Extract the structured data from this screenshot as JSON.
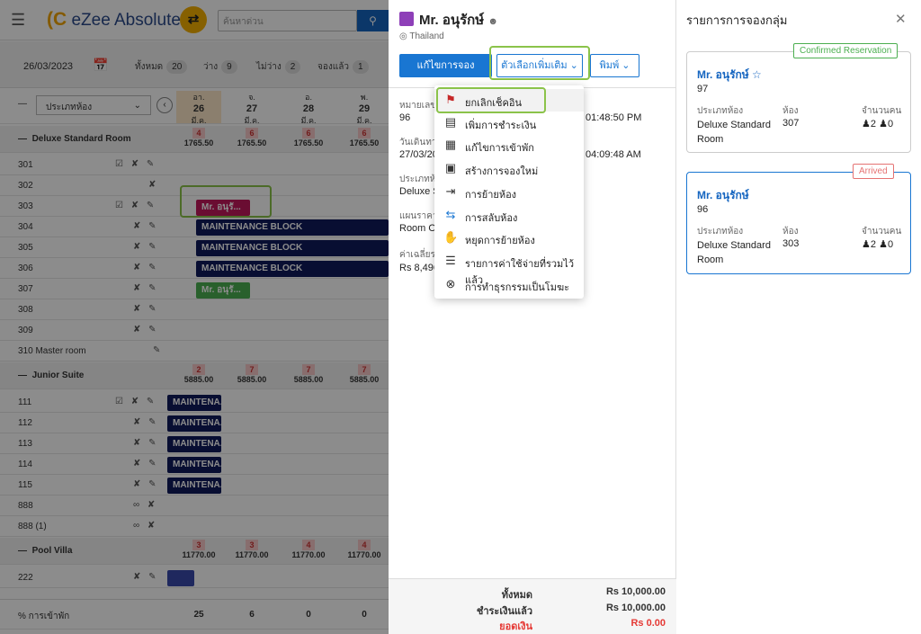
{
  "app": {
    "logo_text": "eZee Absolute",
    "search_placeholder": "ค้นหาด่วน",
    "date": "26/03/2023",
    "stats": [
      {
        "label": "ทั้งหมด",
        "value": "20"
      },
      {
        "label": "ว่าง",
        "value": "9"
      },
      {
        "label": "ไม่ว่าง",
        "value": "2"
      },
      {
        "label": "จองแล้ว",
        "value": "1"
      }
    ],
    "room_type_select": "ประเภทห้อง",
    "dates": [
      {
        "day": "อา.",
        "num": "26",
        "month": "มี.ค."
      },
      {
        "day": "จ.",
        "num": "27",
        "month": "มี.ค."
      },
      {
        "day": "อ.",
        "num": "28",
        "month": "มี.ค."
      },
      {
        "day": "พ.",
        "num": "29",
        "month": "มี.ค."
      }
    ],
    "categories": [
      {
        "name": "Deluxe Standard Room",
        "counts": [
          "4",
          "6",
          "6",
          "6"
        ],
        "prices": [
          "1765.50",
          "1765.50",
          "1765.50",
          "1765.50"
        ]
      },
      {
        "name": "Junior Suite",
        "counts": [
          "2",
          "7",
          "7",
          "7"
        ],
        "prices": [
          "5885.00",
          "5885.00",
          "5885.00",
          "5885.00"
        ]
      },
      {
        "name": "Pool Villa",
        "counts": [
          "3",
          "3",
          "4",
          "4"
        ],
        "prices": [
          "11770.00",
          "11770.00",
          "11770.00",
          "11770.00"
        ]
      }
    ],
    "rooms_deluxe": [
      "301",
      "302",
      "303",
      "304",
      "305",
      "306",
      "307",
      "308",
      "309",
      "310 Master room"
    ],
    "rooms_junior": [
      "111",
      "112",
      "113",
      "114",
      "115",
      "888",
      "888 (1)"
    ],
    "rooms_villa": [
      "222"
    ],
    "maintenance_long": "MAINTENANCE BLOCK",
    "maintenance_short": "MAINTENA...",
    "booking_short": "Mr. อนุรั...",
    "occupancy_label": "% การเข้าพัก",
    "occupancy": [
      "25",
      "6",
      "0",
      "0"
    ]
  },
  "detail": {
    "guest_name": "Mr. อนุรักษ์",
    "country": "Thailand",
    "edit_button": "แก้ไขการจอง",
    "more_button": "ตัวเลือกเพิ่มเติม",
    "print_button": "พิมพ์",
    "field1_label": "หมายเลข",
    "field1_value": "96",
    "field1_time": "01:48:50 PM",
    "field2_label": "วันเดินทาง",
    "field2_value": "27/03/20",
    "field2_time": "04:09:48 AM",
    "field3_label": "ประเภทห้อง",
    "field3_value": "Deluxe S",
    "field4_label": "แผนราคา",
    "field4_value": "Room On",
    "field5_label": "ค่าเฉลี่ยรา",
    "field5_value": "Rs 8,496",
    "totals": [
      {
        "label": "ทั้งหมด",
        "value": "Rs 10,000.00"
      },
      {
        "label": "ชำระเงินแล้ว",
        "value": "Rs 10,000.00"
      },
      {
        "label": "ยอดเงิน",
        "value": "Rs 0.00"
      }
    ]
  },
  "menu": [
    {
      "icon": "cancel-checkin-icon",
      "label": "ยกเลิกเช็คอิน"
    },
    {
      "icon": "add-payment-icon",
      "label": "เพิ่มการชำระเงิน"
    },
    {
      "icon": "edit-stay-icon",
      "label": "แก้ไขการเข้าพัก"
    },
    {
      "icon": "new-booking-icon",
      "label": "สร้างการจองใหม่"
    },
    {
      "icon": "move-room-icon",
      "label": "การย้ายห้อง"
    },
    {
      "icon": "swap-room-icon",
      "label": "การสลับห้อง"
    },
    {
      "icon": "stop-move-icon",
      "label": "หยุดการย้ายห้อง"
    },
    {
      "icon": "expense-list-icon",
      "label": "รายการค่าใช้จ่ายที่รวมไว้แล้ว"
    },
    {
      "icon": "void-transaction-icon",
      "label": "การทำธุรกรรมเป็นโมฆะ"
    }
  ],
  "group": {
    "title": "รายการการจองกลุ่ม",
    "cards": [
      {
        "badge": "Confirmed Reservation",
        "badge_color": "#4caf50",
        "name": "Mr. อนุรักษ์",
        "number": "97",
        "room_type_label": "ประเภทห้อง",
        "room_type": "Deluxe Standard Room",
        "room_label": "ห้อง",
        "room": "307",
        "pax_label": "จำนวนคน",
        "adults": "2",
        "children": "0"
      },
      {
        "badge": "Arrived",
        "badge_color": "#e57373",
        "name": "Mr. อนุรักษ์",
        "number": "96",
        "room_type_label": "ประเภทห้อง",
        "room_type": "Deluxe Standard Room",
        "room_label": "ห้อง",
        "room": "303",
        "pax_label": "จำนวนคน",
        "adults": "2",
        "children": "0"
      }
    ]
  }
}
